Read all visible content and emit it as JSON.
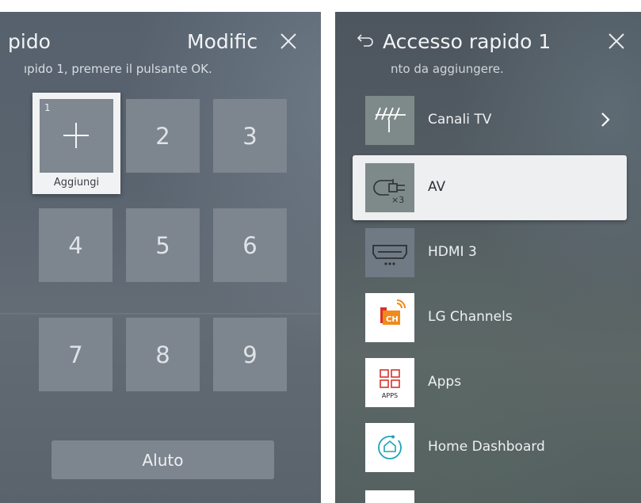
{
  "left_panel": {
    "title": "pido",
    "edit_label": "Modific",
    "subtitle": "ıpido 1, premere il pulsante OK.",
    "selected_tile": {
      "number": "1",
      "caption": "Aggiungi"
    },
    "tiles": [
      "2",
      "3",
      "4",
      "5",
      "6",
      "7",
      "8",
      "9"
    ],
    "help_button": "Aluto"
  },
  "right_panel": {
    "title": "Accesso rapido 1",
    "subtitle": "nto da aggiungere.",
    "items": [
      {
        "label": "Canali TV",
        "icon": "antenna-icon"
      },
      {
        "label": "AV",
        "icon": "av-cable-icon"
      },
      {
        "label": "HDMI 3",
        "icon": "hdmi-icon"
      },
      {
        "label": "LG Channels",
        "icon": "lg-channels-icon"
      },
      {
        "label": "Apps",
        "icon": "apps-icon",
        "icon_text": "APPS"
      },
      {
        "label": "Home Dashboard",
        "icon": "home-dashboard-icon"
      }
    ],
    "selected_index": 1
  },
  "colors": {
    "tile": "#7d858e",
    "selected_bg": "#eeeff0",
    "lg_channels_orange": "#f08a1c",
    "lg_channels_red": "#d9322a",
    "home_dashboard_teal": "#1fa3b5"
  },
  "lg_channels_icon_text": "CH"
}
